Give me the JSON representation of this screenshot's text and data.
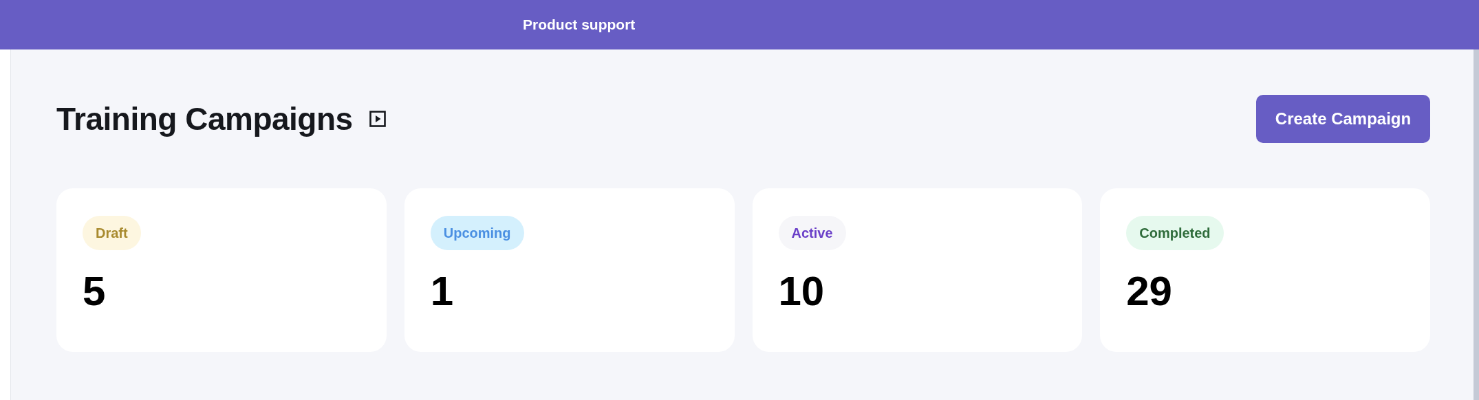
{
  "top_bar": {
    "link": "Product support"
  },
  "header": {
    "title": "Training Campaigns",
    "button": "Create Campaign"
  },
  "status_cards": [
    {
      "kind": "draft",
      "label": "Draft",
      "count": "5"
    },
    {
      "kind": "upcoming",
      "label": "Upcoming",
      "count": "1"
    },
    {
      "kind": "active",
      "label": "Active",
      "count": "10"
    },
    {
      "kind": "completed",
      "label": "Completed",
      "count": "29"
    }
  ]
}
